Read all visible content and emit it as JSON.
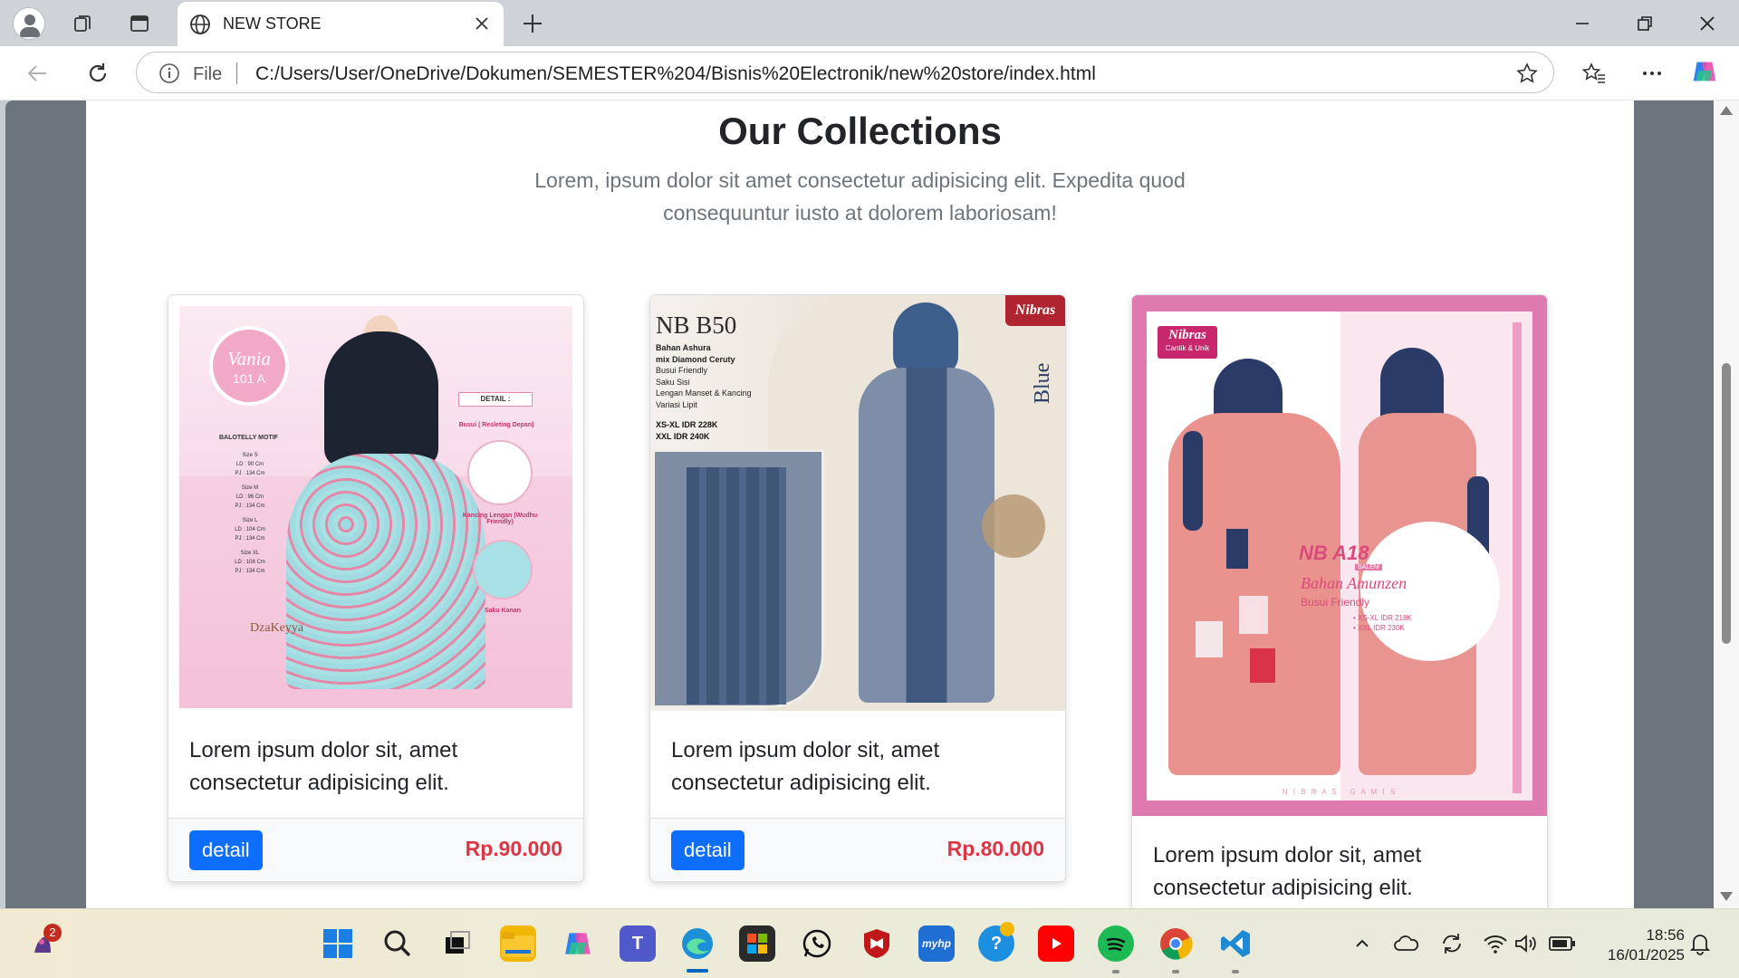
{
  "browser": {
    "tab_title": "NEW STORE",
    "address_scheme": "File",
    "address_url": "C:/Users/User/OneDrive/Dokumen/SEMESTER%204/Bisnis%20Electronik/new%20store/index.html"
  },
  "page": {
    "heading": "Our Collections",
    "lead": "Lorem, ipsum dolor sit amet consectetur adipisicing elit. Expedita quod consequuntur iusto at dolorem laboriosam!"
  },
  "products": [
    {
      "image": {
        "badge_name": "Vania",
        "badge_code": "101 A",
        "detail_label": "DETAIL :",
        "motif": "BALOTELLY MOTIF",
        "sizes": [
          "Size S",
          "LD : 90 Cm",
          "PJ : 134 Cm",
          "Size M",
          "LD : 96 Cm",
          "PJ : 134 Cm",
          "Size L",
          "LD : 104 Cm",
          "PJ : 134 Cm",
          "Size XL",
          "LD : 108 Cm",
          "PJ : 134 Cm"
        ],
        "feature_1": "Busui ( Resleting Depan)",
        "feature_2": "Kancing Lengan (Wudhu Friendly)",
        "feature_3": "Saku Kanan",
        "brand": "DzaKeyya"
      },
      "description": "Lorem ipsum dolor sit, amet consectetur adipisicing elit.",
      "button_label": "detail",
      "price": "Rp.90.000"
    },
    {
      "image": {
        "code": "NB B50",
        "brand": "Nibras",
        "details": [
          "Bahan Ashura",
          "mix Diamond Ceruty",
          "Busui Friendly",
          "Saku Sisi",
          "Lengan Manset & Kancing",
          "Variasi Lipit"
        ],
        "price_1": "XS-XL IDR 228K",
        "price_2": "XXL IDR 240K",
        "color_label": "Blue"
      },
      "description": "Lorem ipsum dolor sit, amet consectetur adipisicing elit.",
      "button_label": "detail",
      "price": "Rp.80.000"
    },
    {
      "image": {
        "brand": "Nibras",
        "tagline": "Cantik & Unik",
        "code": "NB A18",
        "color": "SALEM",
        "fabric": "Bahan Amunzen",
        "feature": "Busui Friendly",
        "price_1": "• XS-XL IDR 218K",
        "price_2": "• XXL IDR 230K",
        "footer": "N I B R A S   G A M I S"
      },
      "description": "Lorem ipsum dolor sit, amet consectetur adipisicing elit."
    }
  ],
  "taskbar": {
    "notification_count": "2",
    "time": "18:56",
    "date": "16/01/2025"
  },
  "colors": {
    "primary": "#0d6efd",
    "price": "#dc3545",
    "side_bg": "#6c757d"
  }
}
